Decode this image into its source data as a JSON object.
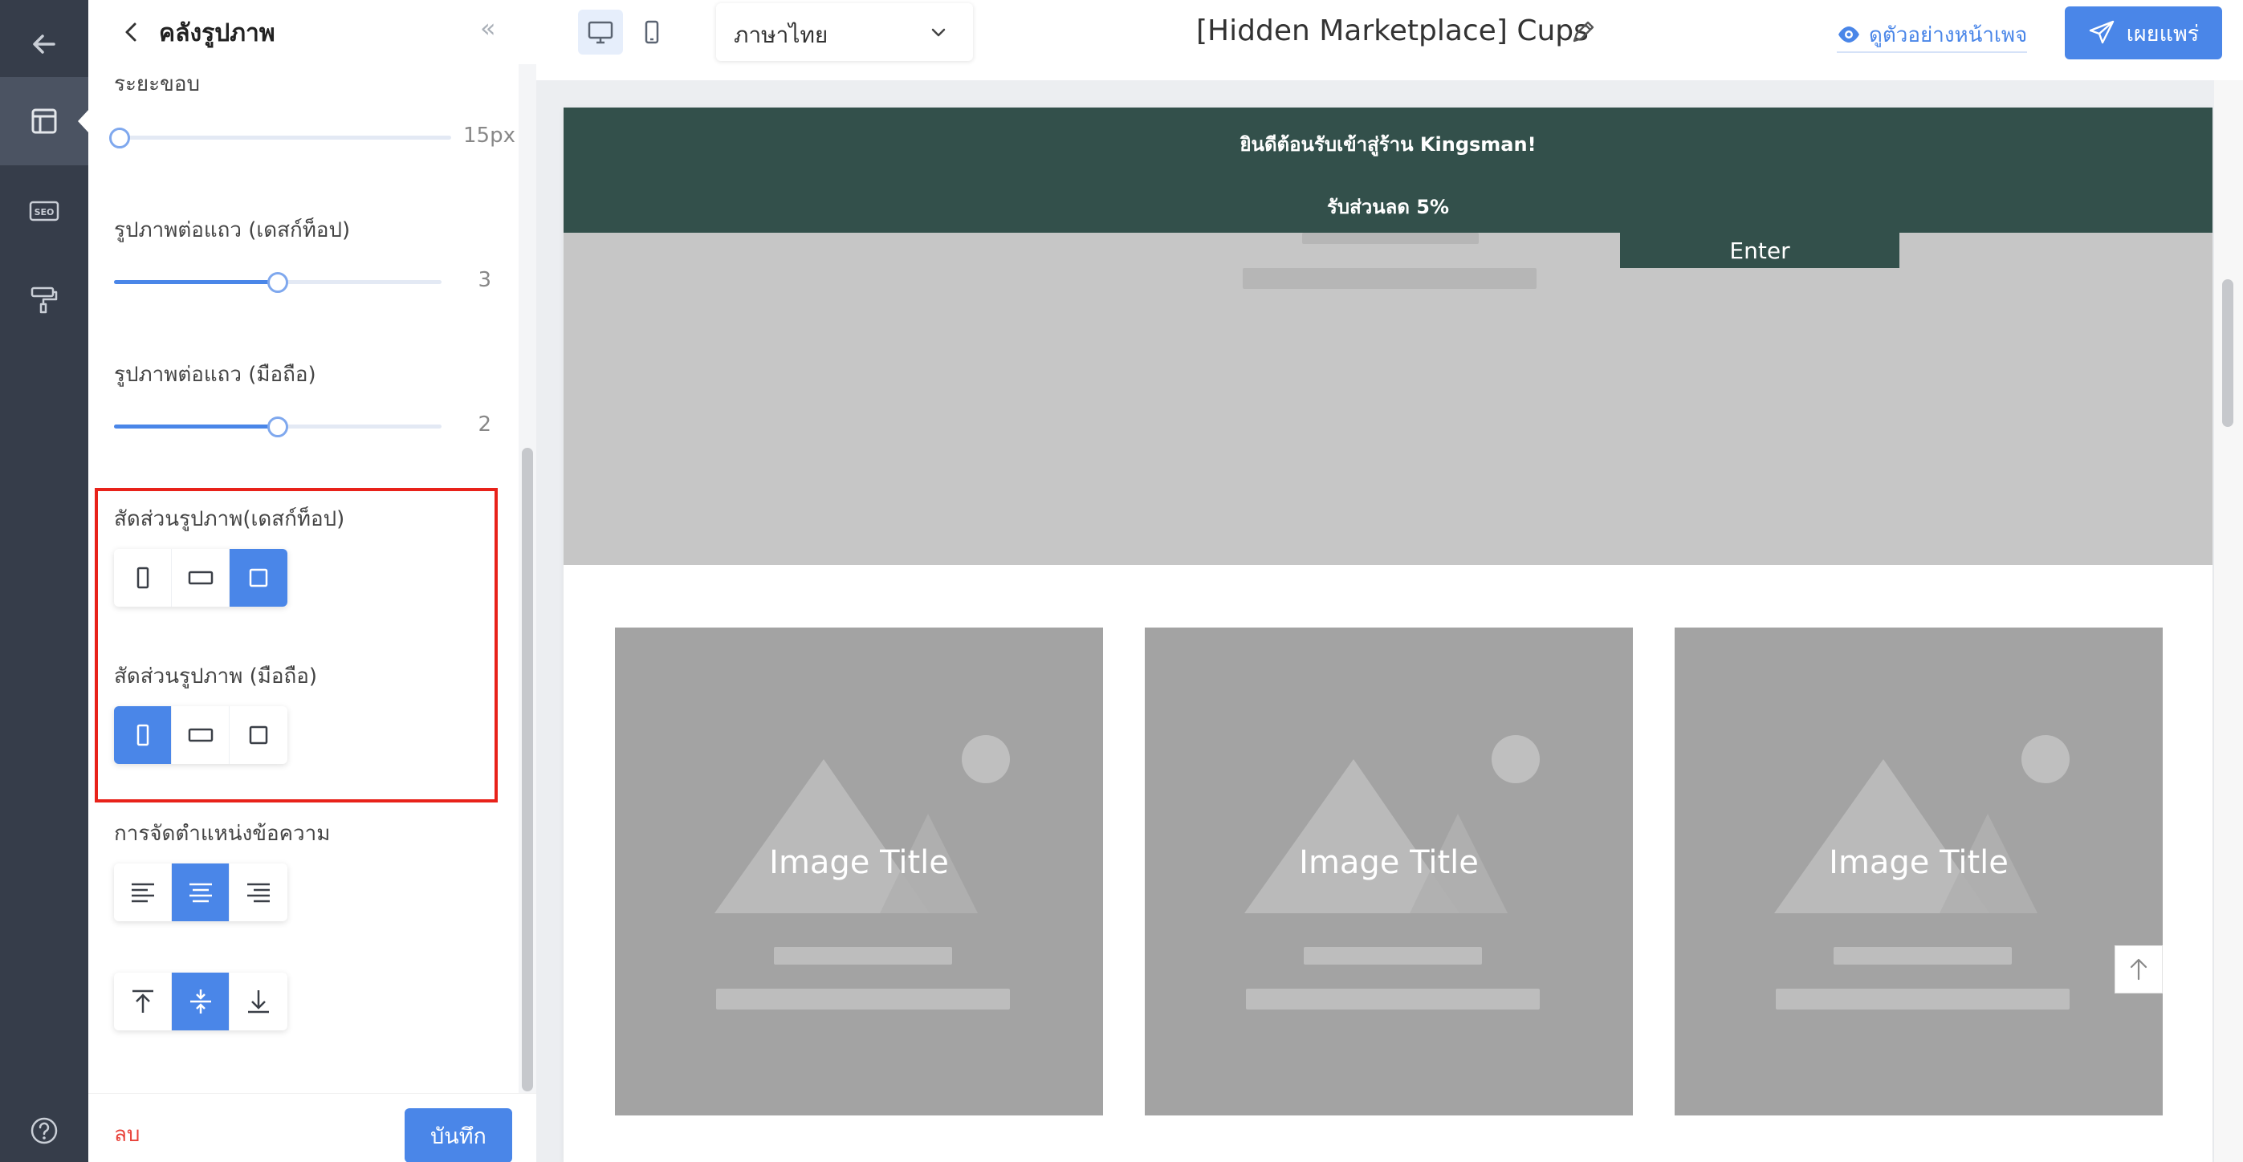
{
  "rail": {
    "items": [
      {
        "icon": "arrow-left-icon"
      },
      {
        "icon": "layout-icon",
        "active": true
      },
      {
        "icon": "seo-icon",
        "text": "SEO"
      },
      {
        "icon": "paint-roller-icon"
      },
      {
        "icon": "help-icon"
      }
    ]
  },
  "panel": {
    "title": "คลังรูปภาพ",
    "collapse_glyph": "«",
    "spacing": {
      "label": "ระยะขอบ",
      "value": 15,
      "display": "15px"
    },
    "per_row_desktop": {
      "label": "รูปภาพต่อแถว (เดสก์ท็อป)",
      "value": 3,
      "display": "3",
      "level": 0.5
    },
    "per_row_mobile": {
      "label": "รูปภาพต่อแถว (มือถือ)",
      "value": 2,
      "display": "2",
      "level": 0.5
    },
    "ratio_desktop": {
      "label": "สัดส่วนรูปภาพ(เดสก์ท็อป)",
      "options": [
        "portrait",
        "landscape",
        "square"
      ],
      "selected": "square"
    },
    "ratio_mobile": {
      "label": "สัดส่วนรูปภาพ (มือถือ)",
      "options": [
        "portrait",
        "landscape",
        "square"
      ],
      "selected": "portrait"
    },
    "text_position": {
      "label": "การจัดตำแหน่งข้อความ",
      "options": [
        "align-left",
        "align-center",
        "align-right"
      ],
      "selected": "align-center"
    },
    "vertical_position": {
      "options": [
        "align-top",
        "align-middle",
        "align-bottom"
      ],
      "selected": "align-middle"
    },
    "delete_label": "ลบ",
    "save_label": "บันทึก"
  },
  "topbar": {
    "devices": [
      "desktop",
      "mobile"
    ],
    "selected_device": "desktop",
    "language": "ภาษาไทย",
    "page_title": "[Hidden Marketplace] Cups",
    "preview_label": "ดูตัวอย่างหน้าเพจ",
    "publish_label": "เผยแพร่"
  },
  "preview": {
    "announcement_line1": "ยินดีต้อนรับเข้าสู่ร้าน Kingsman!",
    "announcement_line2": "รับส่วนลด 5%",
    "enter_label": "Enter",
    "cards": [
      {
        "title": "Image Title"
      },
      {
        "title": "Image Title"
      },
      {
        "title": "Image Title"
      }
    ]
  },
  "colors": {
    "accent": "#4a86e8",
    "rail_bg": "#363d4a",
    "announcement_bg": "#33504b",
    "highlight": "#e8221a",
    "danger": "#e8423a"
  }
}
